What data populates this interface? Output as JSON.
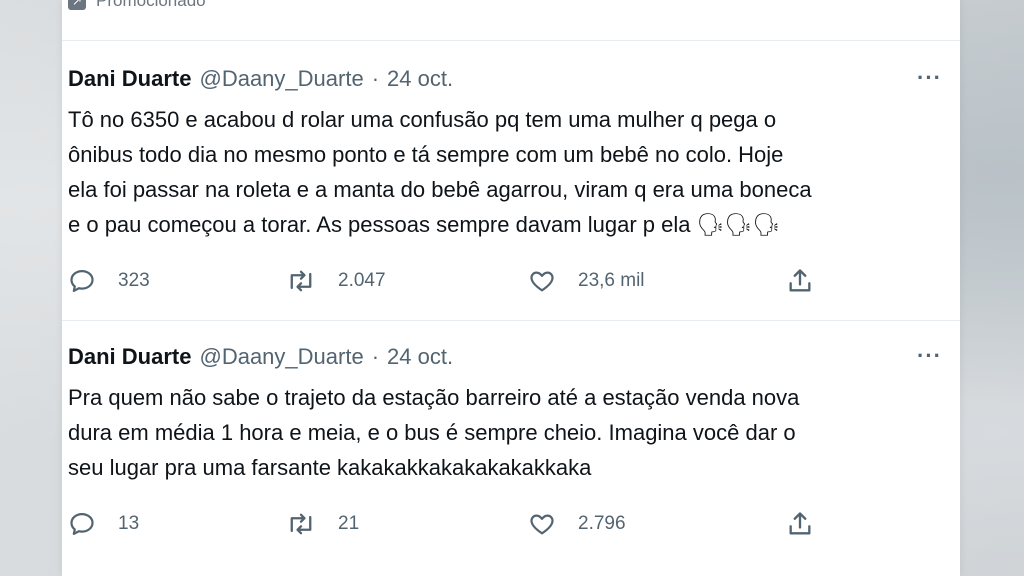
{
  "promo": {
    "label": "Promocionado",
    "icon": "promoted-icon"
  },
  "tweets": [
    {
      "name": "Dani Duarte",
      "handle": "@Daany_Duarte",
      "separator": "·",
      "date": "24 oct.",
      "text": "Tô no 6350 e acabou d rolar uma confusão pq tem uma mulher q pega o\nônibus todo dia no mesmo ponto e tá sempre com um bebê no colo. Hoje\nela foi passar na roleta e a manta do bebê agarrou, viram q era uma boneca\ne o pau começou a torar. As pessoas sempre davam lugar p ela 🗣🗣🗣",
      "replies": "323",
      "retweets": "2.047",
      "likes": "23,6 mil"
    },
    {
      "name": "Dani Duarte",
      "handle": "@Daany_Duarte",
      "separator": "·",
      "date": "24 oct.",
      "text": "Pra quem não sabe o trajeto da estação barreiro até a estação venda nova\ndura em média 1 hora e meia, e o bus é sempre cheio. Imagina você dar o\nseu lugar pra uma farsante kakakakkakakakakakkaka",
      "replies": "13",
      "retweets": "21",
      "likes": "2.796"
    }
  ],
  "more_label": "···",
  "colors": {
    "text": "#0f1419",
    "muted": "#536471",
    "divider": "#e6ecf0"
  }
}
